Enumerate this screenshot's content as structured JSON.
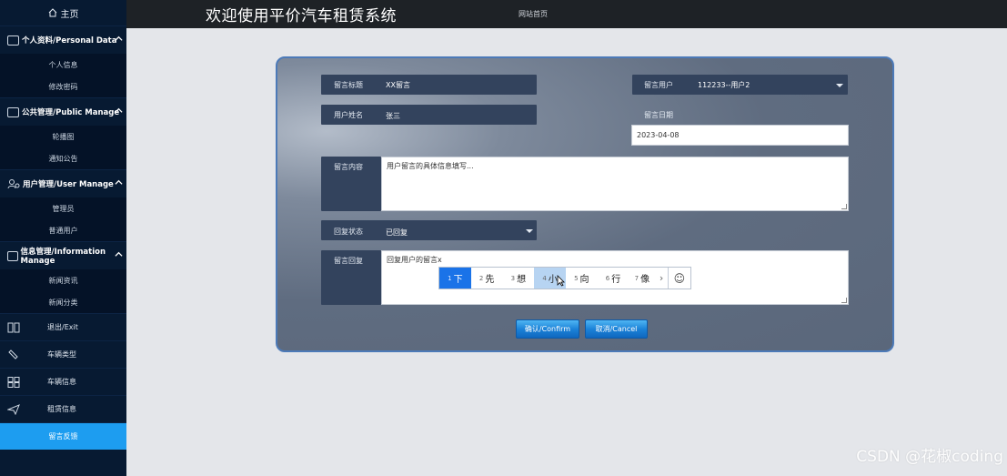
{
  "header": {
    "title": "欢迎使用平价汽车租赁系统",
    "home_link": "网站首页"
  },
  "sidebar": {
    "home": "主页",
    "groups": [
      {
        "label": "个人资料/Personal Data",
        "items": [
          "个人信息",
          "修改密码"
        ]
      },
      {
        "label": "公共管理/Public Manage",
        "items": [
          "轮播图",
          "通知公告"
        ]
      },
      {
        "label": "用户管理/User Manage",
        "items": [
          "管理员",
          "普通用户"
        ]
      },
      {
        "label": "信息管理/Information Manage",
        "items": [
          "新闻资讯",
          "新闻分类"
        ]
      }
    ],
    "items": [
      {
        "label": "退出/Exit",
        "icon": "exit-icon"
      },
      {
        "label": "车辆类型",
        "icon": "tag-icon"
      },
      {
        "label": "车辆信息",
        "icon": "grid-icon"
      },
      {
        "label": "租赁信息",
        "icon": "send-icon"
      },
      {
        "label": "留言反馈",
        "icon": "",
        "active": true
      }
    ]
  },
  "form": {
    "title_label": "留言标题",
    "title_value": "XX留言",
    "user_label": "留言用户",
    "user_value": "112233--用户2",
    "name_label": "用户姓名",
    "name_value": "张三",
    "date_label": "留言日期",
    "date_value": "2023-04-08",
    "content_label": "留言内容",
    "content_value": "用户留言的具体信息填写...",
    "status_label": "回复状态",
    "status_value": "已回复",
    "reply_label": "留言回复",
    "reply_value": "回复用户的留言x"
  },
  "ime": {
    "candidates": [
      {
        "n": "1",
        "c": "下"
      },
      {
        "n": "2",
        "c": "先"
      },
      {
        "n": "3",
        "c": "想"
      },
      {
        "n": "4",
        "c": "小"
      },
      {
        "n": "5",
        "c": "向"
      },
      {
        "n": "6",
        "c": "行"
      },
      {
        "n": "7",
        "c": "像"
      }
    ],
    "more": "›",
    "emoji": "☺"
  },
  "buttons": {
    "confirm": "确认/Confirm",
    "cancel": "取消/Cancel"
  },
  "watermark": "CSDN @花椒coding",
  "colors": {
    "sidebar_bg": "#071a32",
    "active_item": "#1d9df0",
    "header_bg": "#1e2226",
    "field_bg": "#33435d",
    "button_blue": "#1c83d8"
  }
}
